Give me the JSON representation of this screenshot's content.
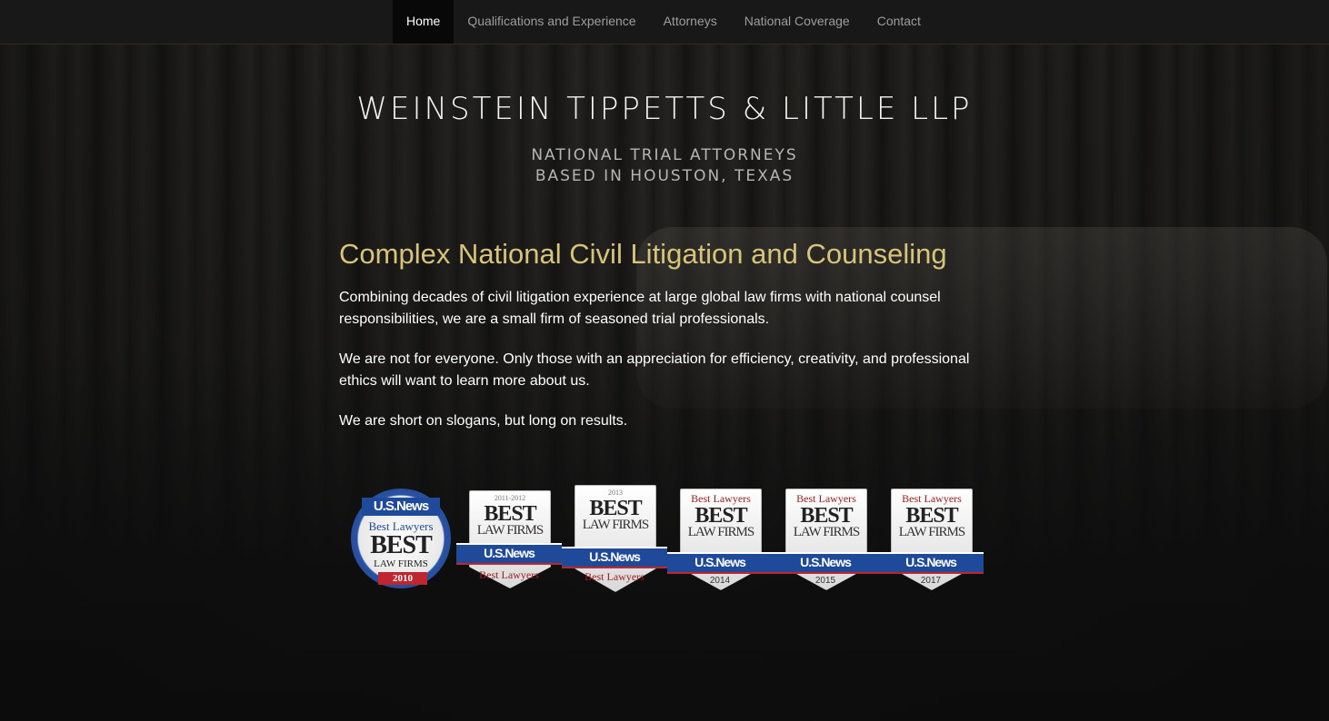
{
  "nav": {
    "items": [
      {
        "label": "Home",
        "active": true
      },
      {
        "label": "Qualifications and Experience",
        "active": false
      },
      {
        "label": "Attorneys",
        "active": false
      },
      {
        "label": "National Coverage",
        "active": false
      },
      {
        "label": "Contact",
        "active": false
      }
    ]
  },
  "hero": {
    "firm_name": "WEINSTEIN TIPPETTS & LITTLE LLP",
    "tagline_line1": "NATIONAL TRIAL ATTORNEYS",
    "tagline_line2": "BASED IN HOUSTON, TEXAS"
  },
  "main": {
    "headline": "Complex National Civil Litigation and Counseling",
    "paragraphs": [
      "Combining decades of civil litigation experience at large global law firms with national counsel responsibilities, we are a small firm of seasoned trial professionals.",
      "We are not for everyone. Only those with an appreciation for efficiency, creativity, and professional ethics will want to learn more about us.",
      "We are short on slogans, but long on results."
    ]
  },
  "badges": [
    {
      "publisher": "U.S.News",
      "sub": "Best Lawyers",
      "title": "BEST",
      "subtitle": "LAW FIRMS",
      "year": "2010"
    },
    {
      "top": "2011-2012",
      "title": "BEST",
      "subtitle": "LAW FIRMS",
      "ribbon": "U.S.News",
      "bottom": "Best Lawyers"
    },
    {
      "top": "2013",
      "title": "BEST",
      "subtitle": "LAW FIRMS",
      "ribbon": "U.S.News",
      "bottom": "Best Lawyers"
    },
    {
      "top": "Best Lawyers",
      "title": "BEST",
      "subtitle": "LAW FIRMS",
      "ribbon": "U.S.News",
      "year": "2014"
    },
    {
      "top": "Best Lawyers",
      "title": "BEST",
      "subtitle": "LAW FIRMS",
      "ribbon": "U.S.News",
      "year": "2015"
    },
    {
      "top": "Best Lawyers",
      "title": "BEST",
      "subtitle": "LAW FIRMS",
      "ribbon": "U.S.News",
      "year": "2017"
    }
  ],
  "colors": {
    "headline": "#d6c47a",
    "nav_active_bg": "#080808",
    "nav_bg": "#181818",
    "badge_blue": "#1f4a9a",
    "badge_red": "#c0262d"
  }
}
